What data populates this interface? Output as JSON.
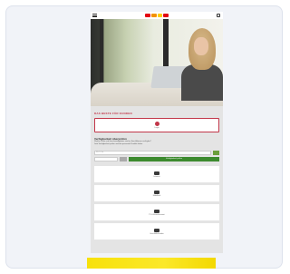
{
  "page": {
    "hero_section_title": "DAS BESTE FÜR KUNDEN",
    "primary_action": {
      "label": "Login",
      "icon": "user-circle-icon"
    },
    "info": {
      "title": "Verfügbarkeit überprüfen",
      "line1": "Welche Tarife und Geschwindigkeiten sind an Ihrer Adresse verfügbar?",
      "line2": "Jetzt Verfügbarkeit prüfen und das passende Produkt finden."
    },
    "search": {
      "placeholder": "PLZ / Ort",
      "button_label": "Verfügbarkeit prüfen"
    },
    "tiles": [
      {
        "label": "Internet",
        "icon": "house-icon"
      },
      {
        "label": "Mobilfunk",
        "icon": "phone-icon"
      },
      {
        "label": "TV & Entertainment",
        "icon": "tv-icon"
      },
      {
        "label": "Geschäftskunden",
        "icon": "briefcase-icon"
      }
    ]
  },
  "colors": {
    "brand_red": "#c2374a",
    "brand_green": "#3c8a2e",
    "banner_yellow": "#f7e10b"
  }
}
